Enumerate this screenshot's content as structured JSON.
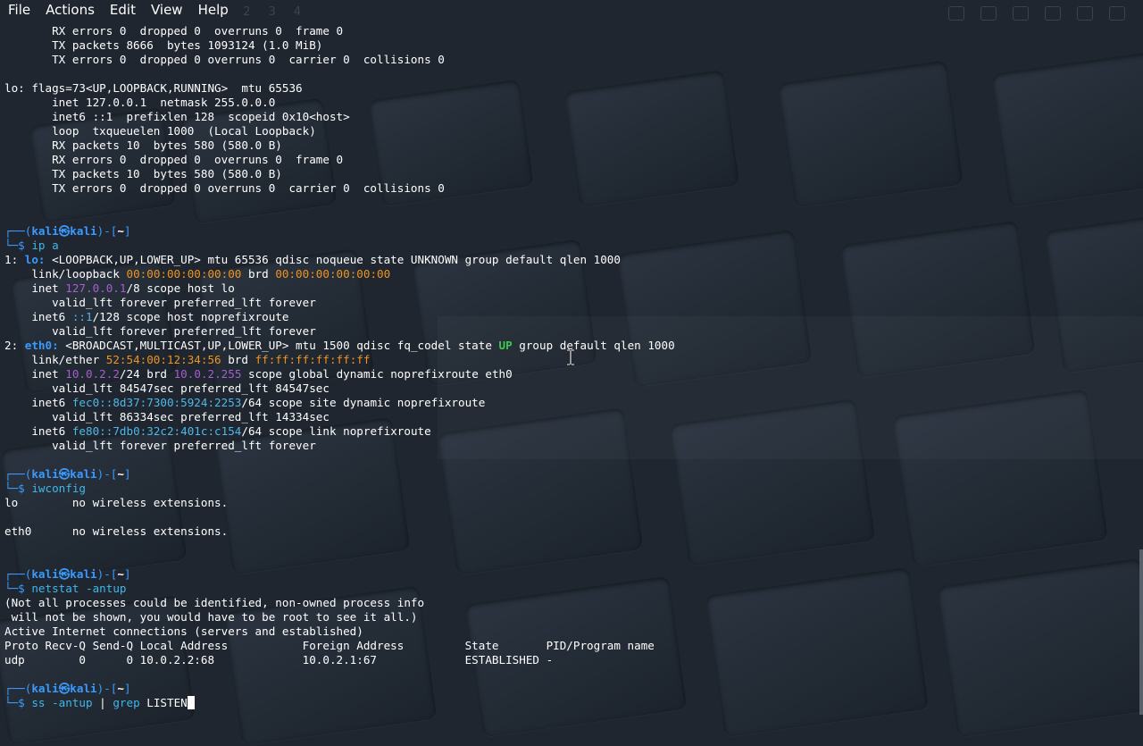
{
  "menu": [
    "File",
    "Actions",
    "Edit",
    "View",
    "Help"
  ],
  "prompt": {
    "user": "kali",
    "host": "kali",
    "cwd": "~",
    "symbol": "$"
  },
  "colors": {
    "prompt_blue": "#3a9bff",
    "mac_orange": "#f0941f",
    "ip_purple": "#a95ccf",
    "ipv6_blue": "#4fb8e8",
    "state_green": "#3ec94f",
    "command_cyan": "#3fb8ea"
  },
  "lines": [
    {
      "segs": [
        [
          "",
          "       RX errors 0  dropped 0  overruns 0  frame 0"
        ]
      ]
    },
    {
      "segs": [
        [
          "",
          "       TX packets 8666  bytes 1093124 (1.0 MiB)"
        ]
      ]
    },
    {
      "segs": [
        [
          "",
          "       TX errors 0  dropped 0 overruns 0  carrier 0  collisions 0"
        ]
      ]
    },
    {
      "segs": []
    },
    {
      "segs": [
        [
          "",
          "lo: flags=73<UP,LOOPBACK,RUNNING>  mtu 65536"
        ]
      ]
    },
    {
      "segs": [
        [
          "",
          "       inet 127.0.0.1  netmask 255.0.0.0"
        ]
      ]
    },
    {
      "segs": [
        [
          "",
          "       inet6 ::1  prefixlen 128  scopeid 0x10<host>"
        ]
      ]
    },
    {
      "segs": [
        [
          "",
          "       loop  txqueuelen 1000  (Local Loopback)"
        ]
      ]
    },
    {
      "segs": [
        [
          "",
          "       RX packets 10  bytes 580 (580.0 B)"
        ]
      ]
    },
    {
      "segs": [
        [
          "",
          "       RX errors 0  dropped 0  overruns 0  frame 0"
        ]
      ]
    },
    {
      "segs": [
        [
          "",
          "       TX packets 10  bytes 580 (580.0 B)"
        ]
      ]
    },
    {
      "segs": [
        [
          "",
          "       TX errors 0  dropped 0 overruns 0  carrier 0  collisions 0"
        ]
      ]
    },
    {
      "segs": []
    },
    {
      "segs": []
    },
    {
      "prompt": true
    },
    {
      "segs": [
        [
          "blue",
          "└─$ "
        ],
        [
          "cmd",
          "ip a"
        ]
      ]
    },
    {
      "segs": [
        [
          "",
          "1: "
        ],
        [
          "blueb",
          "lo:"
        ],
        [
          "",
          " <LOOPBACK,UP,LOWER_UP> mtu 65536 qdisc noqueue state UNKNOWN group default qlen 1000"
        ]
      ]
    },
    {
      "segs": [
        [
          "",
          "    link/loopback "
        ],
        [
          "orange",
          "00:00:00:00:00:00"
        ],
        [
          "",
          " brd "
        ],
        [
          "orange",
          "00:00:00:00:00:00"
        ]
      ]
    },
    {
      "segs": [
        [
          "",
          "    inet "
        ],
        [
          "purple",
          "127.0.0.1"
        ],
        [
          "",
          "/8 scope host lo"
        ]
      ]
    },
    {
      "segs": [
        [
          "",
          "       valid_lft forever preferred_lft forever"
        ]
      ]
    },
    {
      "segs": [
        [
          "",
          "    inet6 "
        ],
        [
          "cyan",
          "::1"
        ],
        [
          "",
          "/128 scope host noprefixroute"
        ]
      ]
    },
    {
      "segs": [
        [
          "",
          "       valid_lft forever preferred_lft forever"
        ]
      ]
    },
    {
      "segs": [
        [
          "",
          "2: "
        ],
        [
          "blueb",
          "eth0:"
        ],
        [
          "",
          " <BROADCAST,MULTICAST,UP,LOWER_UP> mtu 1500 qdisc fq_codel state "
        ],
        [
          "greenb",
          "UP"
        ],
        [
          "",
          " group default qlen 1000"
        ]
      ]
    },
    {
      "segs": [
        [
          "",
          "    link/ether "
        ],
        [
          "orange",
          "52:54:00:12:34:56"
        ],
        [
          "",
          " brd "
        ],
        [
          "orange",
          "ff:ff:ff:ff:ff:ff"
        ]
      ]
    },
    {
      "segs": [
        [
          "",
          "    inet "
        ],
        [
          "purple",
          "10.0.2.2"
        ],
        [
          "",
          "/24 brd "
        ],
        [
          "purple",
          "10.0.2.255"
        ],
        [
          "",
          " scope global dynamic noprefixroute eth0"
        ]
      ]
    },
    {
      "segs": [
        [
          "",
          "       valid_lft 84547sec preferred_lft 84547sec"
        ]
      ]
    },
    {
      "segs": [
        [
          "",
          "    inet6 "
        ],
        [
          "cyan",
          "fec0::8d37:7300:5924:2253"
        ],
        [
          "",
          "/64 scope site dynamic noprefixroute"
        ]
      ]
    },
    {
      "segs": [
        [
          "",
          "       valid_lft 86334sec preferred_lft 14334sec"
        ]
      ]
    },
    {
      "segs": [
        [
          "",
          "    inet6 "
        ],
        [
          "cyan",
          "fe80::7db0:32c2:401c:c154"
        ],
        [
          "",
          "/64 scope link noprefixroute"
        ]
      ]
    },
    {
      "segs": [
        [
          "",
          "       valid_lft forever preferred_lft forever"
        ]
      ]
    },
    {
      "segs": []
    },
    {
      "prompt": true
    },
    {
      "segs": [
        [
          "blue",
          "└─$ "
        ],
        [
          "cmd",
          "iwconfig"
        ]
      ]
    },
    {
      "segs": [
        [
          "",
          "lo        no wireless extensions."
        ]
      ]
    },
    {
      "segs": []
    },
    {
      "segs": [
        [
          "",
          "eth0      no wireless extensions."
        ]
      ]
    },
    {
      "segs": []
    },
    {
      "segs": []
    },
    {
      "prompt": true
    },
    {
      "segs": [
        [
          "blue",
          "└─$ "
        ],
        [
          "cmd",
          "netstat -antup"
        ]
      ]
    },
    {
      "segs": [
        [
          "",
          "(Not all processes could be identified, non-owned process info"
        ]
      ]
    },
    {
      "segs": [
        [
          "",
          " will not be shown, you would have to be root to see it all.)"
        ]
      ]
    },
    {
      "segs": [
        [
          "",
          "Active Internet connections (servers and established)"
        ]
      ]
    },
    {
      "segs": [
        [
          "",
          "Proto Recv-Q Send-Q Local Address           Foreign Address         State       PID/Program name"
        ]
      ]
    },
    {
      "segs": [
        [
          "",
          "udp        0      0 10.0.2.2:68             10.0.2.1:67             ESTABLISHED -"
        ]
      ]
    },
    {
      "segs": []
    },
    {
      "prompt": true
    },
    {
      "segs": [
        [
          "blue",
          "└─$ "
        ],
        [
          "cmd",
          "ss -antup "
        ],
        [
          "",
          "| "
        ],
        [
          "cmd",
          "grep "
        ],
        [
          "",
          "LISTEN"
        ]
      ],
      "cursor": true
    }
  ]
}
